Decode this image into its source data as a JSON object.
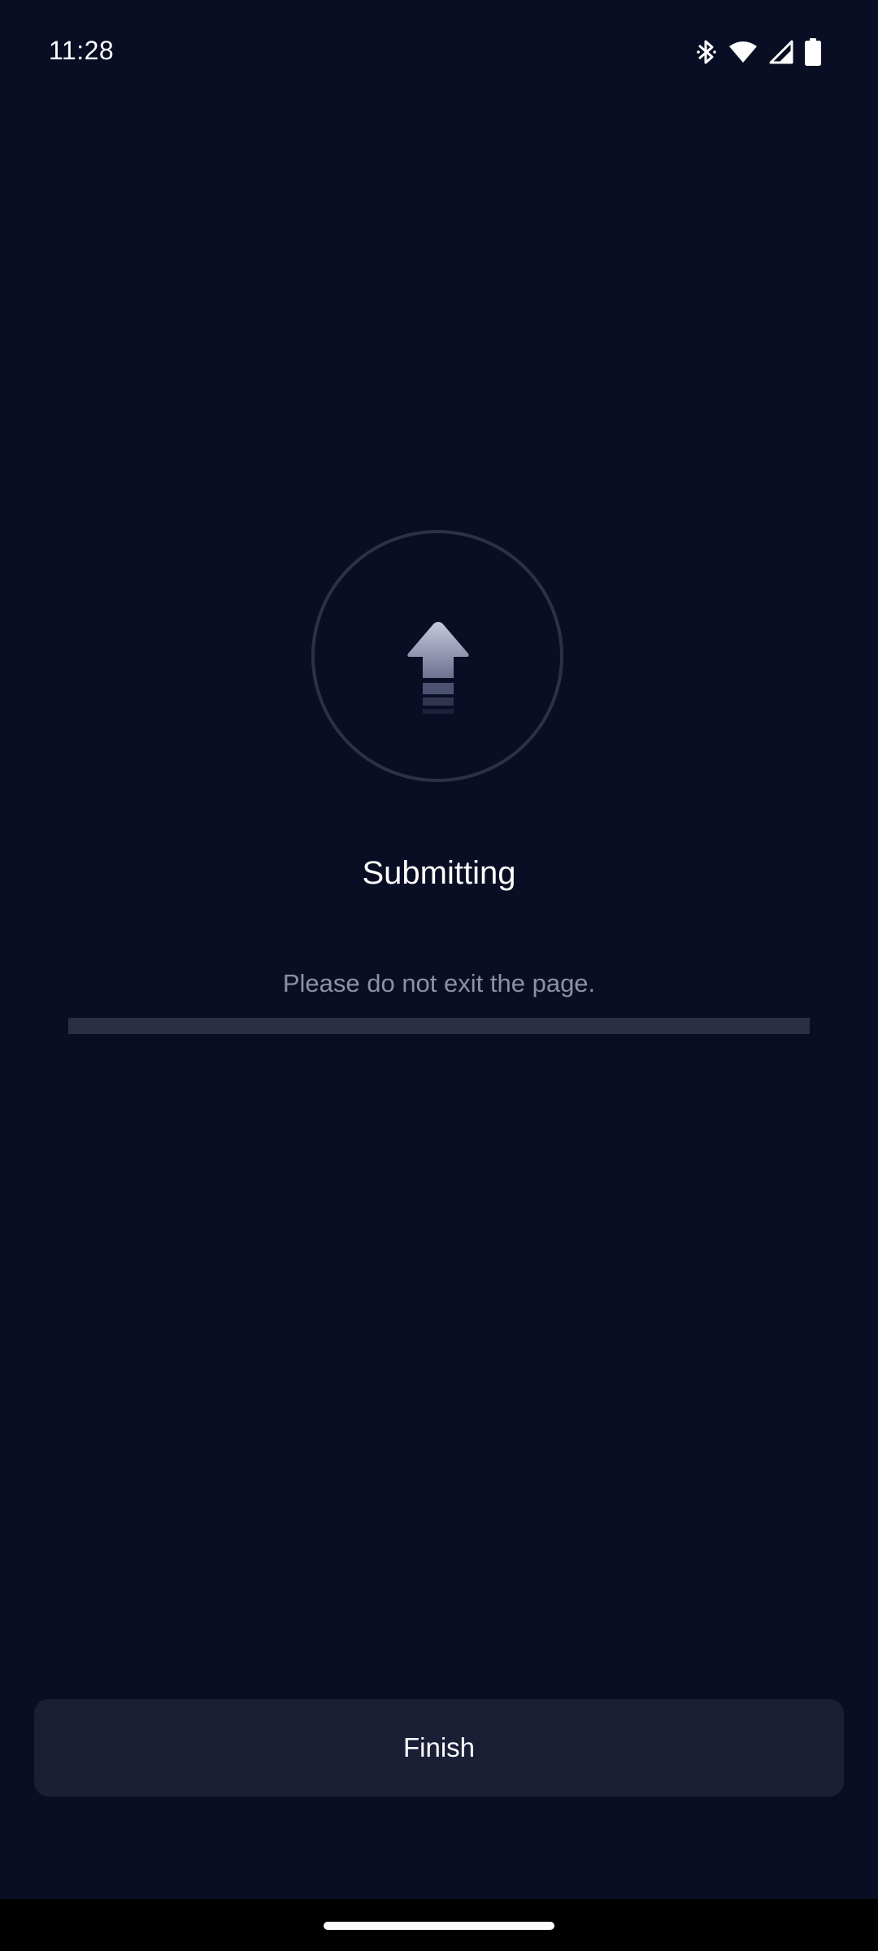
{
  "status_bar": {
    "time": "11:28",
    "icons": [
      "bluetooth-icon",
      "wifi-icon",
      "signal-icon",
      "battery-icon"
    ]
  },
  "upload": {
    "icon": "upload-arrow-icon",
    "title": "Submitting",
    "message": "Please do not exit the page.",
    "progress": 0
  },
  "actions": {
    "finish_label": "Finish"
  },
  "colors": {
    "background": "#0a0e24",
    "button_bg": "#1b1f36",
    "progress_track": "#2b2f45",
    "muted_text": "#8d90a6"
  }
}
